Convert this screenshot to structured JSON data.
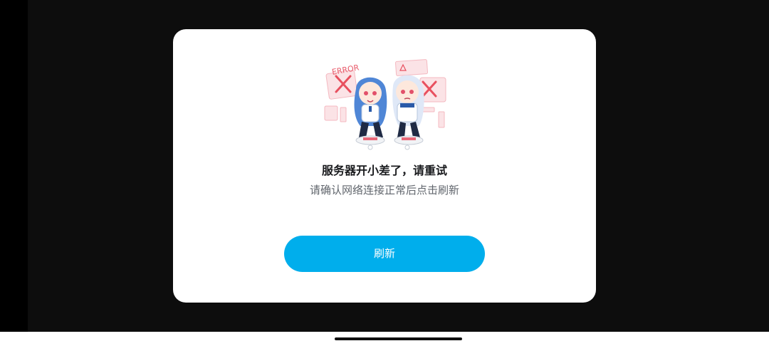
{
  "dialog": {
    "illustration": {
      "error_label": "ERROR",
      "icon": "error-mascots-illustration"
    },
    "title": "服务器开小差了，请重试",
    "subtitle": "请确认网络连接正常后点击刷新",
    "refresh_label": "刷新"
  },
  "colors": {
    "accent": "#00aeec",
    "backdrop": "#0d0d0d",
    "dialog_bg": "#ffffff",
    "title": "#18191c",
    "subtitle": "#61666d"
  }
}
